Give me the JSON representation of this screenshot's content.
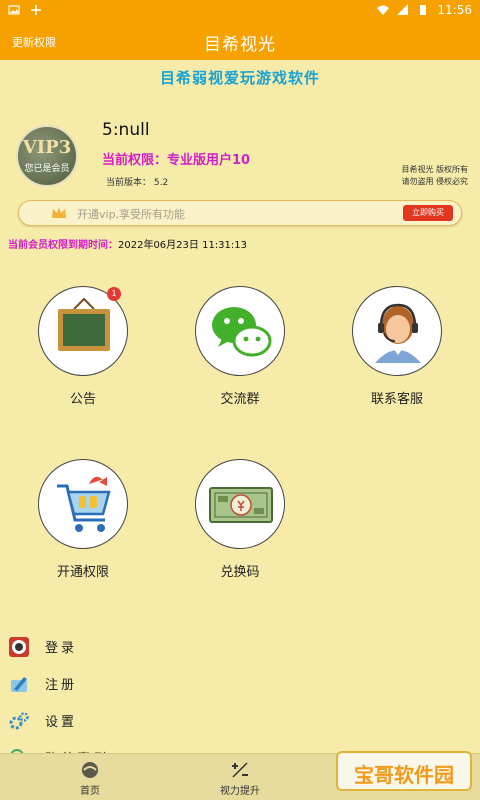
{
  "statusbar": {
    "time": "11:56"
  },
  "appbar": {
    "left_button": "更新权限",
    "title": "目希视光"
  },
  "subtitle": "目希弱视爱玩游戏软件",
  "profile": {
    "avatar_title": "VIP3",
    "avatar_sub": "您已是会员",
    "username": "5:null",
    "permission": "当前权限：专业版用户10",
    "version": "当前版本：  5.2",
    "copyright_line1": "目希视光  版权所有",
    "copyright_line2": "请勿盗用  侵权必究"
  },
  "vip_banner": {
    "text": "开通vip,享受所有功能",
    "button": "立即购买"
  },
  "expire": {
    "label": "当前会员权限到期时间：",
    "value": "2022年06月23日 11:31:13"
  },
  "tiles": [
    {
      "label": "公告",
      "badge": "1"
    },
    {
      "label": "交流群"
    },
    {
      "label": "联系客服"
    },
    {
      "label": "开通权限"
    },
    {
      "label": "兑换码"
    }
  ],
  "menu": [
    {
      "label": "登录",
      "icon": "login-icon"
    },
    {
      "label": "注册",
      "icon": "register-icon"
    },
    {
      "label": "设置",
      "icon": "settings-icon"
    },
    {
      "label": "改善案例",
      "icon": "search-icon"
    }
  ],
  "bottom_nav": [
    {
      "label": "首页",
      "icon": "home-icon"
    },
    {
      "label": "视力提升",
      "icon": "plus-minus-icon"
    }
  ],
  "watermark": "宝哥软件园",
  "colors": {
    "accent": "#f7a100",
    "background": "#f6eba9",
    "permission": "#d41fc9",
    "subtitle": "#19a3d4"
  }
}
